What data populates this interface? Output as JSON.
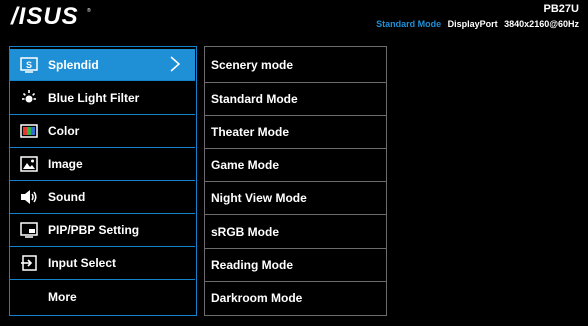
{
  "header": {
    "brand": "ASUS",
    "model": "PB27U",
    "mode": "Standard Mode",
    "input": "DisplayPort",
    "resolution": "3840x2160@60Hz"
  },
  "colors": {
    "accent": "#1f8fd6",
    "border": "#1583cc",
    "sub_border": "#6c6c6c",
    "background": "#000000"
  },
  "menu": {
    "items": [
      {
        "label": "Splendid",
        "icon": "splendid-icon",
        "selected": true
      },
      {
        "label": "Blue Light Filter",
        "icon": "blue-light-filter-icon"
      },
      {
        "label": "Color",
        "icon": "color-icon"
      },
      {
        "label": "Image",
        "icon": "image-icon"
      },
      {
        "label": "Sound",
        "icon": "speaker-icon"
      },
      {
        "label": "PIP/PBP Setting",
        "icon": "pip-icon"
      },
      {
        "label": "Input Select",
        "icon": "input-select-icon"
      },
      {
        "label": "More",
        "icon": ""
      }
    ]
  },
  "submenu": {
    "items": [
      {
        "label": "Scenery mode"
      },
      {
        "label": "Standard Mode"
      },
      {
        "label": "Theater Mode"
      },
      {
        "label": "Game Mode"
      },
      {
        "label": "Night View Mode"
      },
      {
        "label": "sRGB Mode"
      },
      {
        "label": "Reading Mode"
      },
      {
        "label": "Darkroom Mode"
      }
    ]
  }
}
